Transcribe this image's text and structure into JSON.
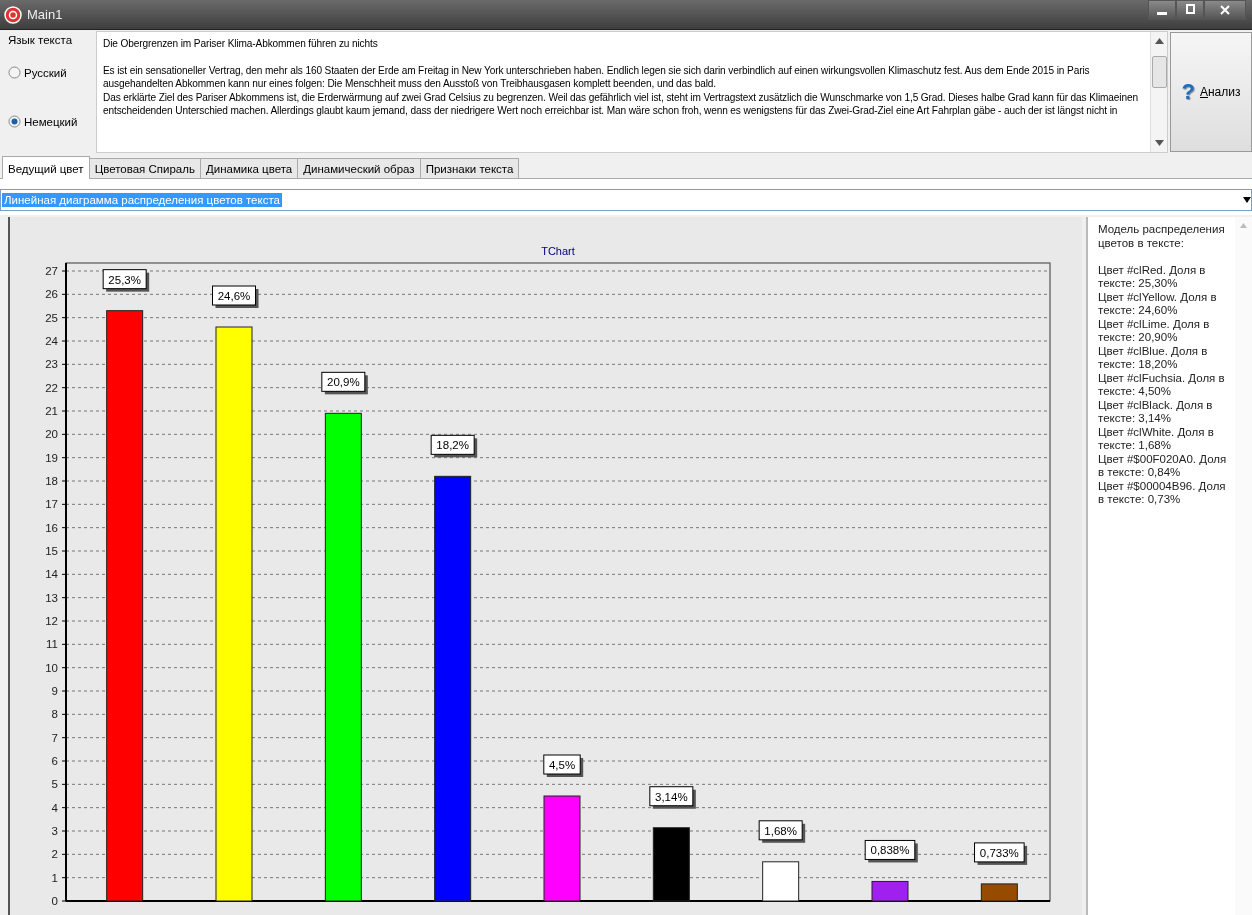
{
  "window": {
    "title": "Main1"
  },
  "language": {
    "label": "Язык текста",
    "options": [
      {
        "label": "Русский",
        "selected": false
      },
      {
        "label": "Немецкий",
        "selected": true
      }
    ]
  },
  "text": {
    "heading": "Die Obergrenzen im Pariser Klima-Abkommen führen zu nichts",
    "lines": [
      "Es ist ein sensationeller Vertrag, den mehr als 160 Staaten der Erde am Freitag in New York unterschrieben haben. Endlich legen sie sich darin verbindlich auf einen wirkungsvollen Klimaschutz fest. Aus dem Ende 2015 in Paris",
      "ausgehandelten Abkommen kann nur eines folgen: Die Menschheit muss den Ausstoß von Treibhausgasen komplett beenden, und das bald.",
      "Das erklärte Ziel des Pariser Abkommens ist, die Erderwärmung auf zwei Grad Celsius zu begrenzen. Weil das gefährlich viel ist, steht im Vertragstext zusätzlich die Wunschmarke von 1,5 Grad. Dieses halbe Grad kann für das Klimaeinen",
      "entscheidenden Unterschied machen. Allerdings glaubt kaum jemand, dass der niedrigere Wert noch erreichbar ist. Man wäre schon froh, wenn es wenigstens für das Zwei-Grad-Ziel eine Art Fahrplan gäbe - auch der ist längst nicht in"
    ]
  },
  "analyze_button": {
    "icon": "?",
    "label": "Анализ"
  },
  "tabs": [
    {
      "label": "Ведущий цвет",
      "selected": true
    },
    {
      "label": "Цветовая Спираль",
      "selected": false
    },
    {
      "label": "Динамика цвета",
      "selected": false
    },
    {
      "label": "Динамический образ",
      "selected": false
    },
    {
      "label": "Признаки текста",
      "selected": false
    }
  ],
  "view_select": {
    "value": "Линейная диаграмма распределения цветов текста"
  },
  "chart": {
    "chart_data": {
      "type": "bar",
      "title": "TChart",
      "grid": true,
      "series": [
        {
          "color": "#ff0000",
          "values": [
            25.3,
            null,
            null,
            null,
            null,
            null,
            null,
            null,
            null
          ]
        },
        {
          "color": "#ffff00",
          "values": [
            null,
            24.6,
            null,
            null,
            null,
            null,
            null,
            null,
            null
          ]
        },
        {
          "color": "#00ff00",
          "values": [
            null,
            null,
            20.9,
            null,
            null,
            null,
            null,
            null,
            null
          ]
        },
        {
          "color": "#0000ff",
          "values": [
            null,
            null,
            null,
            18.2,
            null,
            null,
            null,
            null,
            null
          ]
        },
        {
          "color": "#ff00ff",
          "values": [
            null,
            null,
            null,
            null,
            4.5,
            null,
            null,
            null,
            null
          ]
        },
        {
          "color": "#000000",
          "values": [
            null,
            null,
            null,
            null,
            null,
            3.14,
            null,
            null,
            null
          ]
        },
        {
          "color": "#ffffff",
          "values": [
            null,
            null,
            null,
            null,
            null,
            null,
            1.68,
            null,
            null
          ]
        },
        {
          "color": "#a020f0",
          "values": [
            null,
            null,
            null,
            null,
            null,
            null,
            null,
            0.838,
            null
          ]
        },
        {
          "color": "#964b00",
          "values": [
            null,
            null,
            null,
            null,
            null,
            null,
            null,
            null,
            0.733
          ]
        }
      ],
      "value_labels": [
        "25,3%",
        "24,6%",
        "20,9%",
        "18,2%",
        "4,5%",
        "3,14%",
        "1,68%",
        "0,838%",
        "0,733%"
      ],
      "ylim": [
        0,
        27
      ],
      "yticks": [
        0,
        1,
        2,
        3,
        4,
        5,
        6,
        7,
        8,
        9,
        10,
        11,
        12,
        13,
        14,
        15,
        16,
        17,
        18,
        19,
        20,
        21,
        22,
        23,
        24,
        25,
        26,
        27
      ]
    }
  },
  "model": {
    "heading": "Модель распределения цветов в тексте:",
    "entries": [
      "Цвет #clRed. Доля в тексте: 25,30%",
      "Цвет #clYellow. Доля в тексте: 24,60%",
      "Цвет #clLime. Доля в тексте: 20,90%",
      "Цвет #clBlue. Доля в тексте: 18,20%",
      "Цвет #clFuchsia. Доля в тексте: 4,50%",
      "Цвет #clBlack. Доля в тексте: 3,14%",
      "Цвет #clWhite. Доля в тексте: 1,68%",
      "Цвет #$00F020A0. Доля в тексте: 0,84%",
      "Цвет #$00004B96. Доля в тексте: 0,73%"
    ]
  }
}
